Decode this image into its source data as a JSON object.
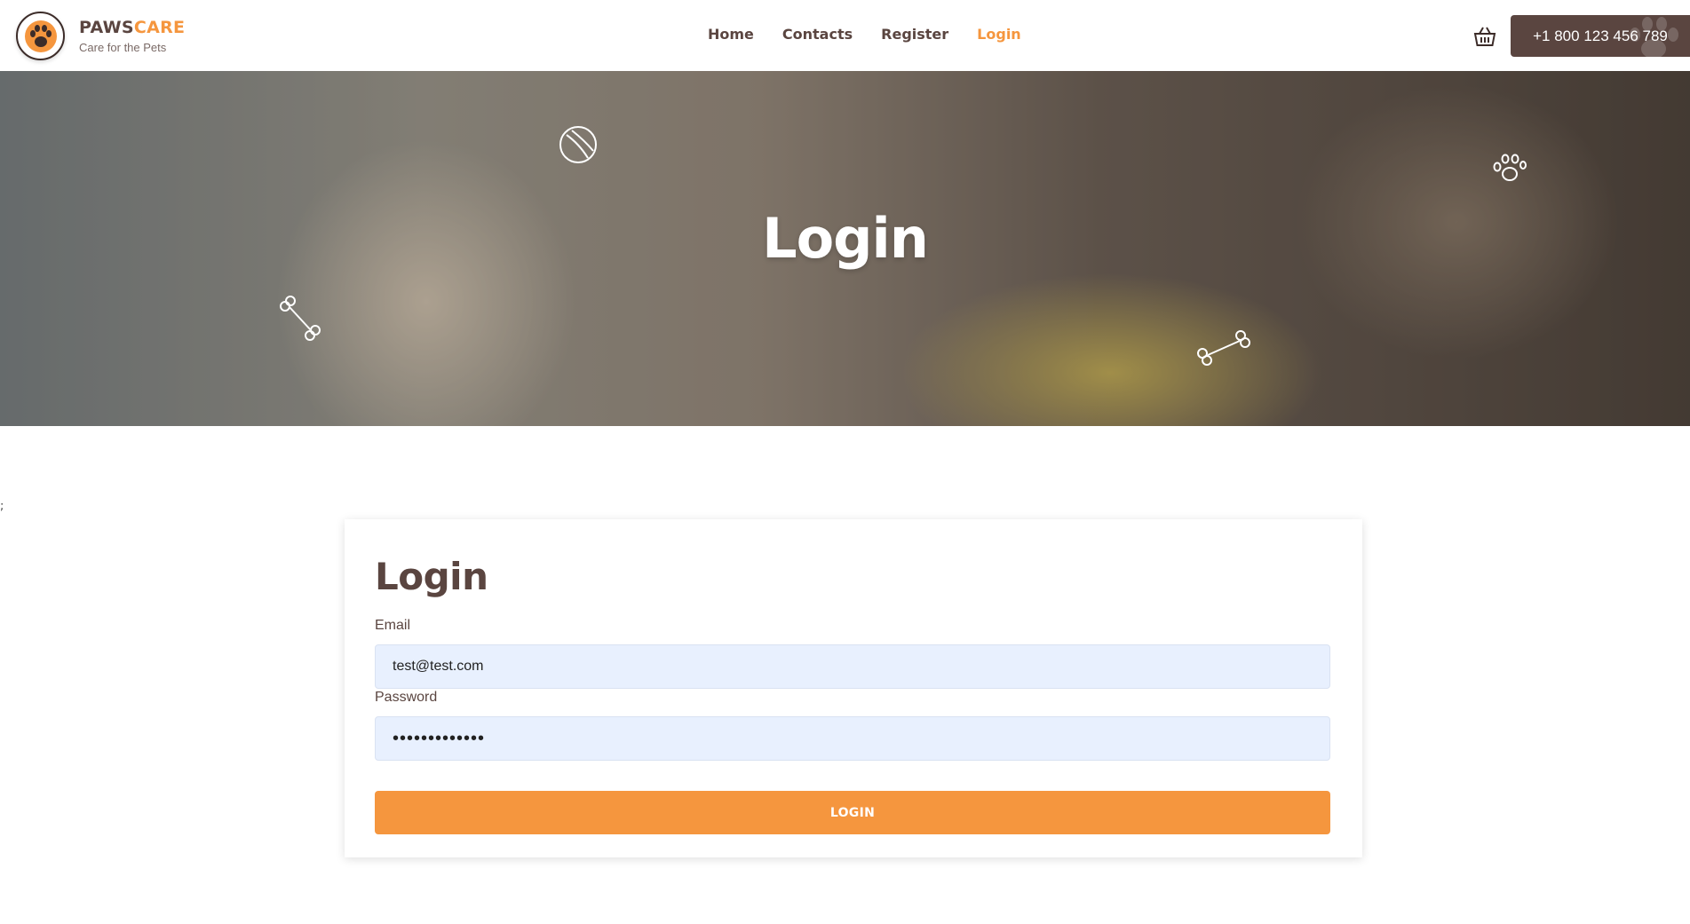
{
  "header": {
    "brand_main": "PAWS",
    "brand_accent": "CARE",
    "tagline": "Care for the Pets",
    "nav": [
      {
        "label": "Home"
      },
      {
        "label": "Contacts"
      },
      {
        "label": "Register"
      },
      {
        "label": "Login",
        "active": true
      }
    ],
    "cart_icon": "basket-icon",
    "phone": "+1 800 123 456 789"
  },
  "hero": {
    "title": "Login",
    "icons": [
      "ball-icon",
      "paw-print-icon",
      "bone-icon",
      "bone-icon"
    ]
  },
  "stray_text": ";",
  "login_form": {
    "title": "Login",
    "email_label": "Email",
    "email_value": "test@test.com",
    "password_label": "Password",
    "password_value": "•••••••••••••",
    "submit_label": "LOGIN"
  },
  "colors": {
    "brand_brown": "#5a4540",
    "accent_orange": "#f5963e",
    "input_bg": "#e8f0fe"
  }
}
